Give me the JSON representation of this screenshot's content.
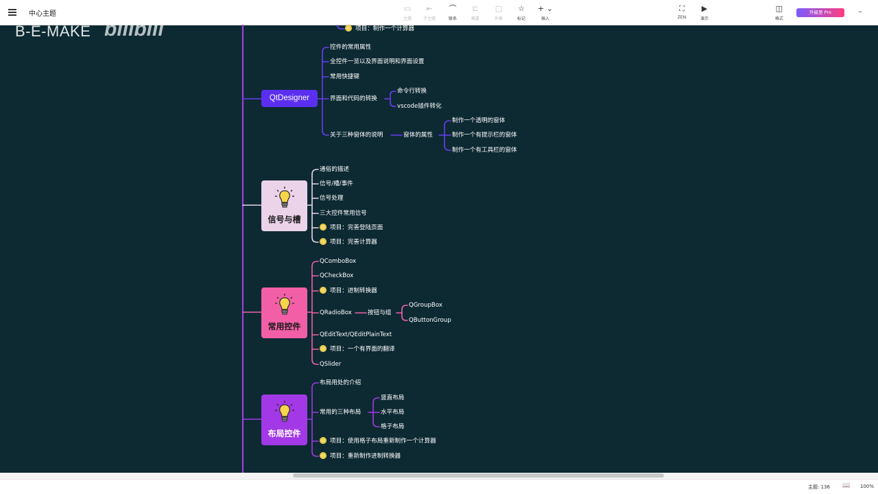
{
  "app": {
    "doc_title": "中心主题",
    "toolbar": {
      "items": [
        {
          "label": "主题",
          "icon": "topic-icon",
          "glyph": "▭",
          "enabled": false
        },
        {
          "label": "子主题",
          "icon": "subtopic-icon",
          "glyph": "⇤",
          "enabled": false
        },
        {
          "label": "联系",
          "icon": "connect-icon",
          "glyph": "⌒",
          "enabled": true
        },
        {
          "label": "概要",
          "icon": "summary-icon",
          "glyph": "⊏",
          "enabled": false
        },
        {
          "label": "外框",
          "icon": "boundary-icon",
          "glyph": "▢",
          "enabled": false
        },
        {
          "label": "标记",
          "icon": "star-icon",
          "glyph": "☆",
          "enabled": true
        },
        {
          "label": "插入",
          "icon": "insert-icon",
          "glyph": "+ ⌄",
          "enabled": true
        }
      ],
      "zen": {
        "label": "ZEN",
        "glyph": "⛶"
      },
      "present": {
        "label": "演示",
        "glyph": "▶"
      },
      "format": {
        "label": "格式",
        "glyph": "◫"
      },
      "pro_button": "升级至 Pro",
      "minimize": "–"
    },
    "status": {
      "topics": "主题: 136",
      "zoom": "100%"
    }
  },
  "watermark": {
    "text": "B-E-MAKE",
    "logo": "bilibili"
  },
  "colors": {
    "canvas": "#0d2a33",
    "trunk": "#9b3fe0",
    "qt": "#5b2ff0",
    "signal": "#ebd3ea",
    "widgets": "#f25fa7",
    "layout": "#a238e6",
    "bulb": "#f1d96b"
  },
  "mindmap": {
    "top_partial": "项目：制作一个计算器",
    "qtdesigner": {
      "label": "QtDesigner",
      "children": {
        "props": "控件的常用属性",
        "overview": "全控件一览以及界面说明和界面设置",
        "shortcuts": "常用快捷键",
        "convert": "界面和代码的转换",
        "convert_cmd": "命令行转换",
        "convert_vscode": "vscode插件转化",
        "windows": "关于三种窗体的说明",
        "window_props": "窗体的属性",
        "win1": "制作一个透明的窗体",
        "win2": "制作一个有提示栏的窗体",
        "win3": "制作一个有工具栏的窗体"
      }
    },
    "signal": {
      "label": "信号与槽",
      "children": [
        "通俗的描述",
        "信号/槽/事件",
        "信号处理",
        "三大控件常用信号",
        "项目：完善登陆页面",
        "项目：完善计算器"
      ]
    },
    "widgets": {
      "label": "常用控件",
      "children": {
        "combo": "QComboBox",
        "check": "QCheckBox",
        "proj_convert": "项目：进制转换器",
        "radio": "QRadioBox",
        "radio_group": "按钮与组",
        "groupbox": "QGroupBox",
        "buttongroup": "QButtonGroup",
        "edit": "QEditText/QEditPlainText",
        "proj_translate": "项目：一个有界面的翻译",
        "slider": "QSlider"
      }
    },
    "layout": {
      "label": "布局控件",
      "children": {
        "intro": "布局用处的介绍",
        "three": "常用的三种布局",
        "vertical": "竖直布局",
        "horizontal": "水平布局",
        "grid": "格子布局",
        "proj_calc": "项目：使用格子布局重新制作一个计算器",
        "proj_remake": "项目：重新制作进制转换器"
      }
    }
  }
}
